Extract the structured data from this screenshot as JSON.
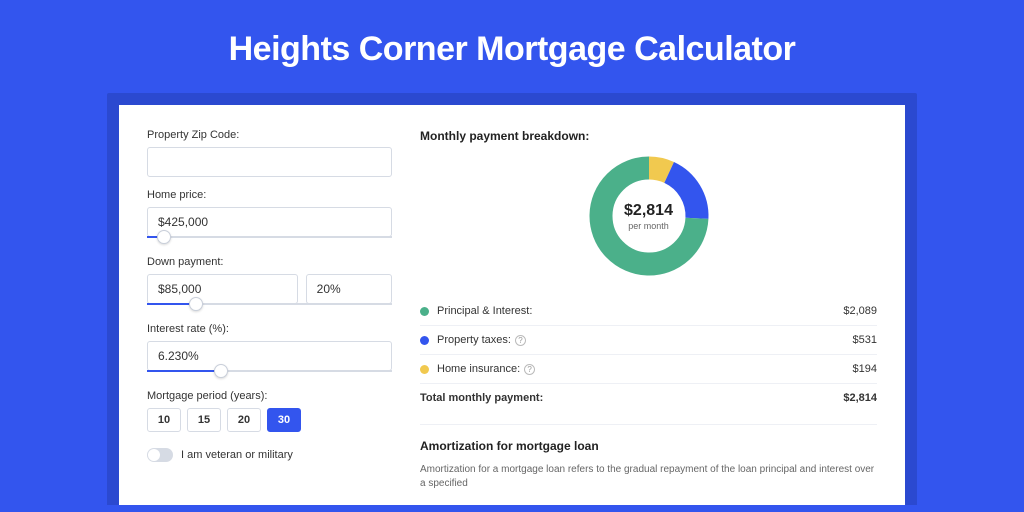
{
  "title": "Heights Corner Mortgage Calculator",
  "form": {
    "zip_label": "Property Zip Code:",
    "zip_value": "",
    "home_price_label": "Home price:",
    "home_price_value": "$425,000",
    "home_price_pct": 7,
    "down_label": "Down payment:",
    "down_value": "$85,000",
    "down_pct_value": "20%",
    "down_slider_pct": 20,
    "rate_label": "Interest rate (%):",
    "rate_value": "6.230%",
    "rate_slider_pct": 30,
    "period_label": "Mortgage period (years):",
    "periods": [
      "10",
      "15",
      "20",
      "30"
    ],
    "period_active": "30",
    "veteran_label": "I am veteran or military"
  },
  "breakdown": {
    "title": "Monthly payment breakdown:",
    "center_amount": "$2,814",
    "center_sub": "per month",
    "items": [
      {
        "label": "Principal & Interest:",
        "value": "$2,089",
        "color": "#4bb08a",
        "info": false
      },
      {
        "label": "Property taxes:",
        "value": "$531",
        "color": "#3355ee",
        "info": true
      },
      {
        "label": "Home insurance:",
        "value": "$194",
        "color": "#f1c94f",
        "info": true
      }
    ],
    "total_label": "Total monthly payment:",
    "total_value": "$2,814"
  },
  "chart_data": {
    "type": "pie",
    "title": "Monthly payment breakdown",
    "series": [
      {
        "name": "Principal & Interest",
        "value": 2089,
        "color": "#4bb08a"
      },
      {
        "name": "Property taxes",
        "value": 531,
        "color": "#3355ee"
      },
      {
        "name": "Home insurance",
        "value": 194,
        "color": "#f1c94f"
      }
    ],
    "total": 2814
  },
  "amort": {
    "title": "Amortization for mortgage loan",
    "text": "Amortization for a mortgage loan refers to the gradual repayment of the loan principal and interest over a specified"
  }
}
